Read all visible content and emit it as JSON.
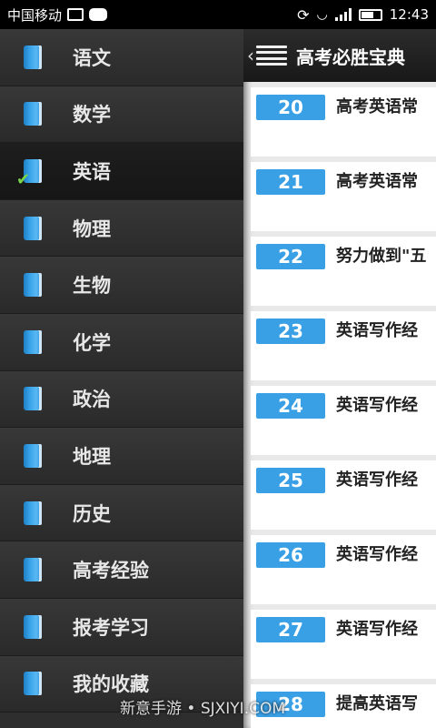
{
  "status_bar": {
    "carrier": "中国移动",
    "time": "12:43",
    "icons": [
      "image-icon",
      "message-icon",
      "sync-icon",
      "wifi-icon",
      "signal-icon",
      "battery-icon"
    ]
  },
  "drawer": {
    "items": [
      {
        "label": "语文",
        "selected": false
      },
      {
        "label": "数学",
        "selected": false
      },
      {
        "label": "英语",
        "selected": true
      },
      {
        "label": "物理",
        "selected": false
      },
      {
        "label": "生物",
        "selected": false
      },
      {
        "label": "化学",
        "selected": false
      },
      {
        "label": "政治",
        "selected": false
      },
      {
        "label": "地理",
        "selected": false
      },
      {
        "label": "历史",
        "selected": false
      },
      {
        "label": "高考经验",
        "selected": false
      },
      {
        "label": "报考学习",
        "selected": false
      },
      {
        "label": "我的收藏",
        "selected": false
      }
    ]
  },
  "header": {
    "back_glyph": "‹",
    "title": "高考必胜宝典"
  },
  "list": [
    {
      "number": "20",
      "title": "高考英语常"
    },
    {
      "number": "21",
      "title": "高考英语常"
    },
    {
      "number": "22",
      "title": "努力做到\"五"
    },
    {
      "number": "23",
      "title": "英语写作经"
    },
    {
      "number": "24",
      "title": "英语写作经"
    },
    {
      "number": "25",
      "title": "英语写作经"
    },
    {
      "number": "26",
      "title": "英语写作经"
    },
    {
      "number": "27",
      "title": "英语写作经"
    },
    {
      "number": "28",
      "title": "提高英语写"
    }
  ],
  "watermark": "新意手游 • SJXIYI.COM",
  "colors": {
    "badge": "#3aa0e6",
    "drawer_bg": "#2e2e2e",
    "check": "#7ad44a"
  }
}
